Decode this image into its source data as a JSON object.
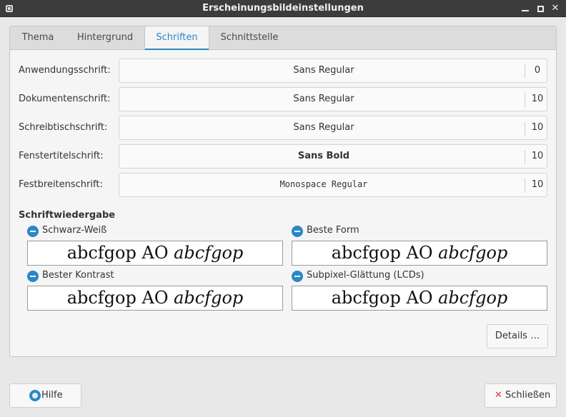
{
  "window": {
    "title": "Erscheinungsbildeinstellungen",
    "controls": {
      "minimize": "minimize-icon",
      "maximize": "maximize-icon",
      "close": "close-icon",
      "close_glyph": "✕"
    }
  },
  "tabs": [
    {
      "label": "Thema",
      "active": false
    },
    {
      "label": "Hintergrund",
      "active": false
    },
    {
      "label": "Schriften",
      "active": true
    },
    {
      "label": "Schnittstelle",
      "active": false
    }
  ],
  "fonts": [
    {
      "label": "Anwendungsschrift:",
      "font": "Sans Regular",
      "size": "0"
    },
    {
      "label": "Dokumentenschrift:",
      "font": "Sans Regular",
      "size": "10"
    },
    {
      "label": "Schreibtischschrift:",
      "font": "Sans Regular",
      "size": "10"
    },
    {
      "label": "Fenstertitelschrift:",
      "font": "Sans Bold",
      "size": "10"
    },
    {
      "label": "Festbreitenschrift:",
      "font": "Monospace Regular",
      "size": "10"
    }
  ],
  "rendering": {
    "title": "Schriftwiedergabe",
    "sample_regular": "abcfgop AO ",
    "sample_italic": "abcfgop",
    "options": [
      {
        "label": "Schwarz-Weiß"
      },
      {
        "label": "Beste Form"
      },
      {
        "label": "Bester Kontrast"
      },
      {
        "label": "Subpixel-Glättung (LCDs)"
      }
    ],
    "details_button": "Details …"
  },
  "footer": {
    "help_label": "Hilfe",
    "close_label": "Schließen",
    "close_glyph": "✕"
  },
  "colors": {
    "accent": "#2b87c6",
    "titlebar": "#3c3c3c",
    "close_icon": "#d63c3c"
  }
}
